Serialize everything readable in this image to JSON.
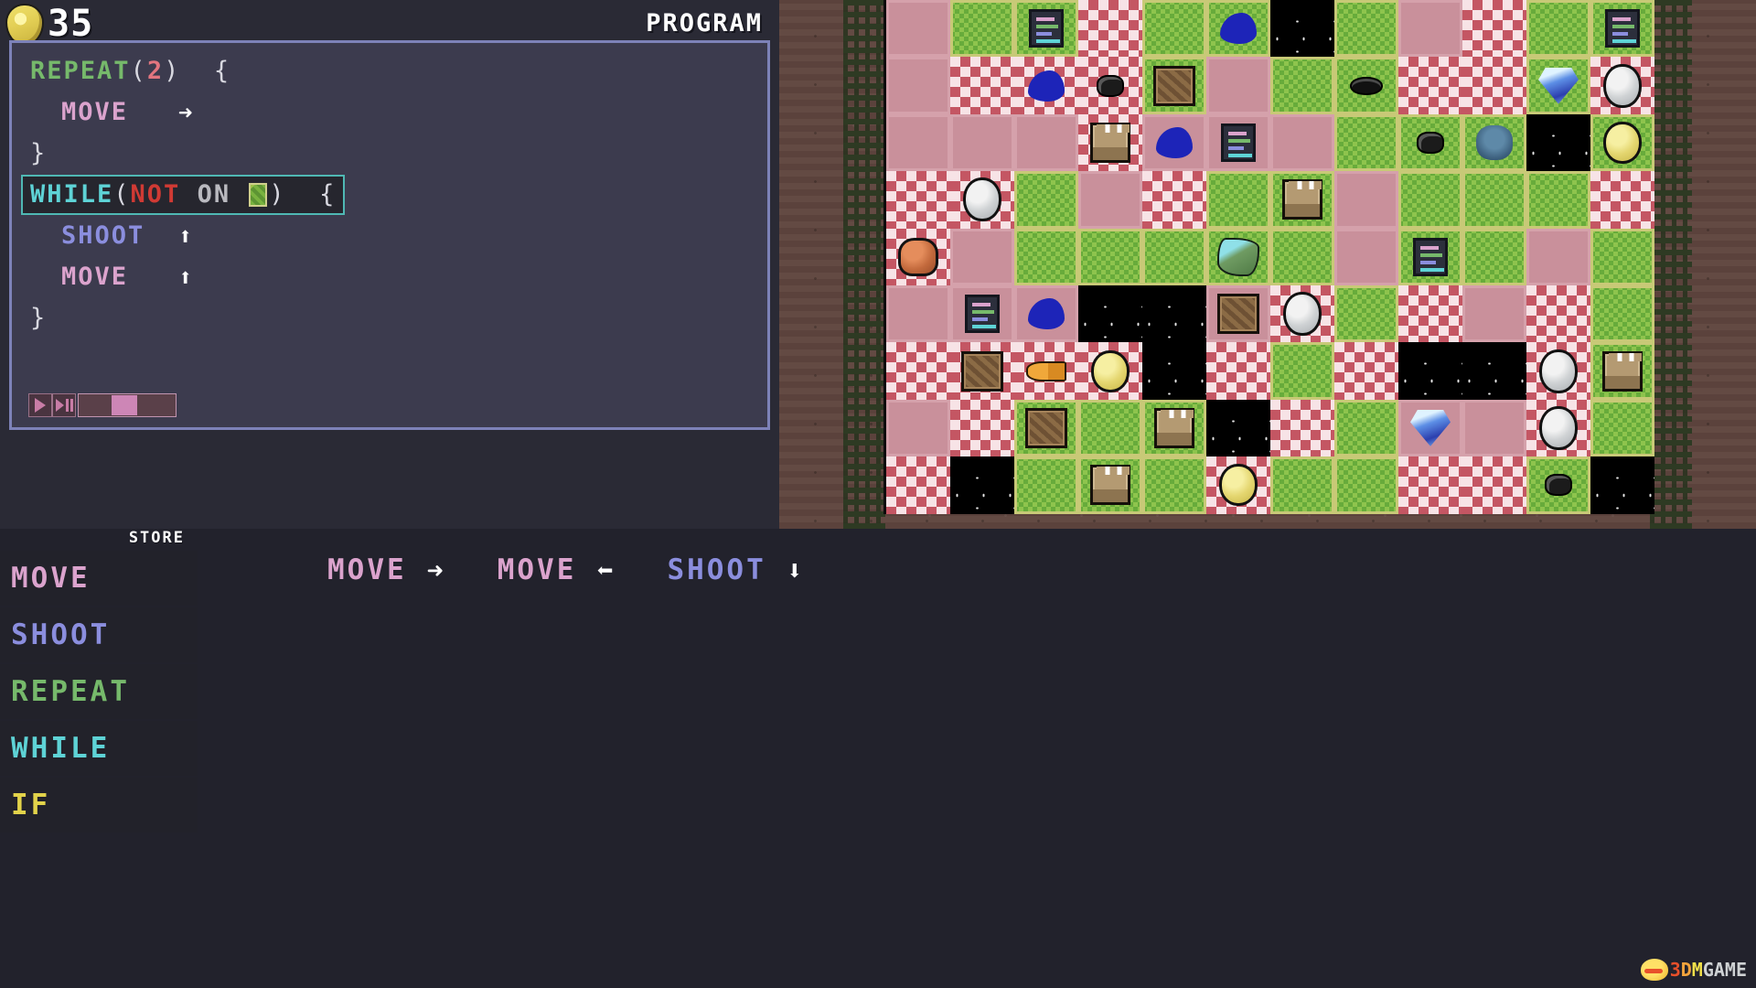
{
  "hud": {
    "coin_icon": "coin-icon",
    "coin_count": "35",
    "panel_title": "PROGRAM"
  },
  "program": {
    "lines": [
      {
        "indent": 0,
        "highlighted": false,
        "tokens": [
          {
            "t": "REPEAT",
            "c": "kw-repeat"
          },
          {
            "t": "(",
            "c": "punct"
          },
          {
            "t": "2",
            "c": "num"
          },
          {
            "t": ")",
            "c": "punct"
          },
          {
            "t": "  ",
            "c": "punct"
          },
          {
            "t": "{",
            "c": "punct"
          }
        ]
      },
      {
        "indent": 1,
        "highlighted": false,
        "tokens": [
          {
            "t": "MOVE",
            "c": "kw-move"
          },
          {
            "t": "   ",
            "c": "punct"
          },
          {
            "t": "➜",
            "c": "arrow"
          }
        ]
      },
      {
        "indent": 0,
        "highlighted": false,
        "tokens": [
          {
            "t": "}",
            "c": "punct"
          }
        ]
      },
      {
        "indent": 0,
        "highlighted": true,
        "tokens": [
          {
            "t": "WHILE",
            "c": "kw-while"
          },
          {
            "t": "(",
            "c": "punct"
          },
          {
            "t": "NOT",
            "c": "kw-not"
          },
          {
            "t": " ",
            "c": "punct"
          },
          {
            "t": "ON",
            "c": "kw-on"
          },
          {
            "t": " ",
            "c": "punct"
          },
          {
            "t": "",
            "c": "grass-chip"
          },
          {
            "t": ")",
            "c": "punct"
          },
          {
            "t": "  ",
            "c": "punct"
          },
          {
            "t": "{",
            "c": "punct"
          }
        ]
      },
      {
        "indent": 1,
        "highlighted": false,
        "tokens": [
          {
            "t": "SHOOT",
            "c": "kw-shoot"
          },
          {
            "t": "  ",
            "c": "punct"
          },
          {
            "t": "⬆",
            "c": "arrow"
          }
        ]
      },
      {
        "indent": 1,
        "highlighted": false,
        "tokens": [
          {
            "t": "MOVE",
            "c": "kw-move"
          },
          {
            "t": "   ",
            "c": "punct"
          },
          {
            "t": "⬆",
            "c": "arrow"
          }
        ]
      },
      {
        "indent": 0,
        "highlighted": false,
        "tokens": [
          {
            "t": "}",
            "c": "punct"
          }
        ]
      }
    ]
  },
  "playback": {
    "play_label": "play",
    "step_label": "step",
    "speed_value": 45
  },
  "store": {
    "label": "STORE",
    "items": [
      {
        "label": "MOVE",
        "color": "#dba3cd"
      },
      {
        "label": "SHOOT",
        "color": "#8b8ede"
      },
      {
        "label": "REPEAT",
        "color": "#76b96b"
      },
      {
        "label": "WHILE",
        "color": "#5ed3d6"
      },
      {
        "label": "IF",
        "color": "#e2d34a"
      }
    ]
  },
  "tray": {
    "commands": [
      {
        "label": "MOVE",
        "color": "#dba3cd",
        "arrow": "➜",
        "dir": "right"
      },
      {
        "label": "MOVE",
        "color": "#dba3cd",
        "arrow": "⬅",
        "dir": "left"
      },
      {
        "label": "SHOOT",
        "color": "#8b8ede",
        "arrow": "⬇",
        "dir": "down"
      }
    ]
  },
  "board": {
    "columns": 12,
    "rows": 9,
    "tile_legend": {
      "p": "plain-pink-tile",
      "c": "checker-tile",
      "g": "grass-tile",
      "s": "space-tile"
    },
    "tiles": [
      [
        "p",
        "g",
        "g",
        "c",
        "g",
        "g",
        "s",
        "g",
        "p",
        "c",
        "g",
        "g"
      ],
      [
        "p",
        "c",
        "c",
        "c",
        "g",
        "p",
        "g",
        "g",
        "c",
        "c",
        "g",
        "c"
      ],
      [
        "p",
        "p",
        "p",
        "c",
        "p",
        "p",
        "p",
        "g",
        "g",
        "g",
        "s",
        "g"
      ],
      [
        "c",
        "c",
        "g",
        "p",
        "c",
        "g",
        "g",
        "p",
        "g",
        "g",
        "g",
        "c"
      ],
      [
        "c",
        "p",
        "g",
        "g",
        "g",
        "g",
        "g",
        "p",
        "g",
        "g",
        "p",
        "g"
      ],
      [
        "p",
        "p",
        "p",
        "s",
        "s",
        "p",
        "c",
        "g",
        "c",
        "p",
        "c",
        "g"
      ],
      [
        "c",
        "c",
        "c",
        "c",
        "s",
        "c",
        "g",
        "c",
        "s",
        "s",
        "c",
        "g"
      ],
      [
        "p",
        "c",
        "g",
        "g",
        "g",
        "s",
        "c",
        "g",
        "p",
        "p",
        "c",
        "g"
      ],
      [
        "c",
        "s",
        "g",
        "g",
        "g",
        "c",
        "g",
        "g",
        "c",
        "c",
        "g",
        "s"
      ]
    ],
    "sprites": [
      {
        "row": 0,
        "col": 2,
        "name": "terminal"
      },
      {
        "row": 0,
        "col": 5,
        "name": "slime"
      },
      {
        "row": 0,
        "col": 11,
        "name": "terminal"
      },
      {
        "row": 1,
        "col": 2,
        "name": "slime"
      },
      {
        "row": 1,
        "col": 3,
        "name": "bug"
      },
      {
        "row": 1,
        "col": 4,
        "name": "crate"
      },
      {
        "row": 1,
        "col": 7,
        "name": "bug2"
      },
      {
        "row": 1,
        "col": 10,
        "name": "gem"
      },
      {
        "row": 1,
        "col": 11,
        "name": "rock"
      },
      {
        "row": 2,
        "col": 3,
        "name": "tower"
      },
      {
        "row": 2,
        "col": 4,
        "name": "slime"
      },
      {
        "row": 2,
        "col": 5,
        "name": "terminal"
      },
      {
        "row": 2,
        "col": 8,
        "name": "bug"
      },
      {
        "row": 2,
        "col": 9,
        "name": "spider"
      },
      {
        "row": 2,
        "col": 11,
        "name": "gold"
      },
      {
        "row": 3,
        "col": 1,
        "name": "rock"
      },
      {
        "row": 3,
        "col": 6,
        "name": "tower"
      },
      {
        "row": 4,
        "col": 0,
        "name": "monster"
      },
      {
        "row": 4,
        "col": 5,
        "name": "fish"
      },
      {
        "row": 4,
        "col": 8,
        "name": "terminal"
      },
      {
        "row": 5,
        "col": 1,
        "name": "terminal"
      },
      {
        "row": 5,
        "col": 2,
        "name": "slime"
      },
      {
        "row": 5,
        "col": 5,
        "name": "crate"
      },
      {
        "row": 5,
        "col": 6,
        "name": "rock"
      },
      {
        "row": 6,
        "col": 1,
        "name": "crate"
      },
      {
        "row": 6,
        "col": 2,
        "name": "key"
      },
      {
        "row": 6,
        "col": 3,
        "name": "gold"
      },
      {
        "row": 6,
        "col": 10,
        "name": "rock"
      },
      {
        "row": 6,
        "col": 11,
        "name": "tower"
      },
      {
        "row": 7,
        "col": 2,
        "name": "crate"
      },
      {
        "row": 7,
        "col": 4,
        "name": "tower"
      },
      {
        "row": 7,
        "col": 8,
        "name": "gem"
      },
      {
        "row": 7,
        "col": 10,
        "name": "rock"
      },
      {
        "row": 8,
        "col": 3,
        "name": "tower"
      },
      {
        "row": 8,
        "col": 5,
        "name": "gold"
      },
      {
        "row": 8,
        "col": 10,
        "name": "bug"
      }
    ]
  },
  "watermark": {
    "parts": [
      "3",
      "D",
      "M",
      "GAME"
    ]
  }
}
